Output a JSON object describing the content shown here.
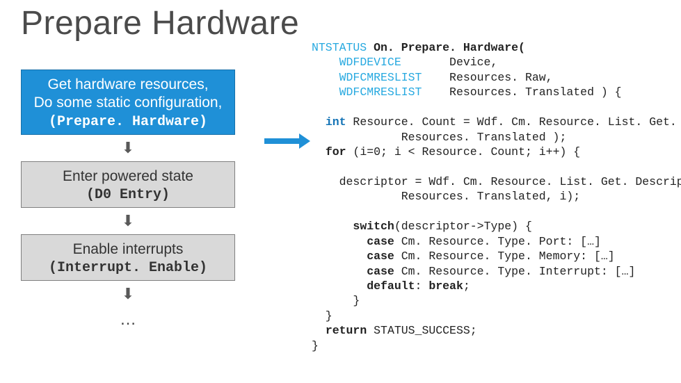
{
  "title": "Prepare Hardware",
  "flow": {
    "step1": {
      "l1": "Get hardware resources,",
      "l2": "Do some static configuration,",
      "mono": "(Prepare. Hardware)"
    },
    "step2": {
      "l1": "Enter powered state",
      "mono": "(D0 Entry)"
    },
    "step3": {
      "l1": "Enable interrupts",
      "mono": "(Interrupt. Enable)"
    },
    "ellipsis": "…"
  },
  "arrow_glyph": "⬇",
  "code": {
    "l01a": "NTSTATUS",
    "l01b": " On. Prepare. Hardware(",
    "l02a": "    ",
    "l02b": "WDFDEVICE",
    "l02c": "       Device,",
    "l03a": "    ",
    "l03b": "WDFCMRESLIST",
    "l03c": "    Resources. Raw,",
    "l04a": "    ",
    "l04b": "WDFCMRESLIST",
    "l04c": "    Resources. Translated ) {",
    "blank1": " ",
    "l05a": "  ",
    "l05b": "int",
    "l05c": " Resource. Count = Wdf. Cm. Resource. List. Get. Count(",
    "l06": "             Resources. Translated );",
    "l07a": "  ",
    "l07b": "for",
    "l07c": " (i=0; i < Resource. Count; i++) {",
    "blank2": " ",
    "l08": "    descriptor = Wdf. Cm. Resource. List. Get. Descriptor(",
    "l09": "             Resources. Translated, i);",
    "blank3": " ",
    "l10a": "      ",
    "l10b": "switch",
    "l10c": "(descriptor->Type) {",
    "l11a": "        ",
    "l11b": "case",
    "l11c": " Cm. Resource. Type. Port: […]",
    "l12a": "        ",
    "l12b": "case",
    "l12c": " Cm. Resource. Type. Memory: […]",
    "l13a": "        ",
    "l13b": "case",
    "l13c": " Cm. Resource. Type. Interrupt: […]",
    "l14a": "        ",
    "l14b": "default",
    "l14c": ": ",
    "l14d": "break",
    "l14e": ";",
    "l15": "      }",
    "l16": "  }",
    "l17a": "  ",
    "l17b": "return",
    "l17c": " STATUS_SUCCESS;",
    "l18": "}"
  }
}
